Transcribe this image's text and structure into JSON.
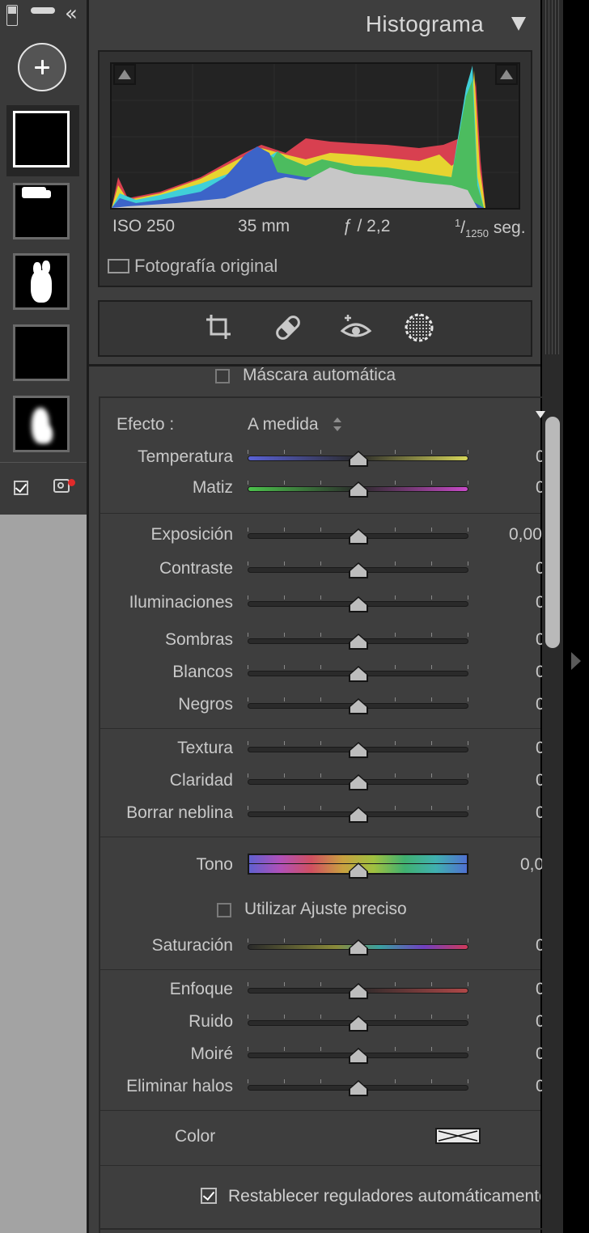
{
  "histogram": {
    "title": "Histograma",
    "exif": {
      "iso": "ISO 250",
      "focal": "35 mm",
      "aperture": "ƒ / 2,2",
      "shutter_num": "1",
      "shutter_den": "1250",
      "shutter_unit": "seg."
    },
    "original_photo_label": "Fotografía original"
  },
  "tools": [
    "crop-icon",
    "healing-icon",
    "redeye-icon",
    "masking-icon"
  ],
  "mask": {
    "auto_mask_label": "Máscara automática",
    "effect_label": "Efecto :",
    "effect_value": "A medida"
  },
  "sliders": {
    "temperatura": {
      "label": "Temperatura",
      "value": "0"
    },
    "matiz": {
      "label": "Matiz",
      "value": "0"
    },
    "exposicion": {
      "label": "Exposición",
      "value": "0,00"
    },
    "contraste": {
      "label": "Contraste",
      "value": "0"
    },
    "iluminaciones": {
      "label": "Iluminaciones",
      "value": "0"
    },
    "sombras": {
      "label": "Sombras",
      "value": "0"
    },
    "blancos": {
      "label": "Blancos",
      "value": "0"
    },
    "negros": {
      "label": "Negros",
      "value": "0"
    },
    "textura": {
      "label": "Textura",
      "value": "0"
    },
    "claridad": {
      "label": "Claridad",
      "value": "0"
    },
    "borrar_neblina": {
      "label": "Borrar neblina",
      "value": "0"
    },
    "tono": {
      "label": "Tono",
      "value": "0,0"
    },
    "saturacion": {
      "label": "Saturación",
      "value": "0"
    },
    "enfoque": {
      "label": "Enfoque",
      "value": "0"
    },
    "ruido": {
      "label": "Ruido",
      "value": "0"
    },
    "moire": {
      "label": "Moiré",
      "value": "0"
    },
    "eliminar_halos": {
      "label": "Eliminar halos",
      "value": "0"
    }
  },
  "precise_label": "Utilizar Ajuste preciso",
  "color_label": "Color",
  "reset_label": "Restablecer reguladores automáticamente",
  "colors": {
    "panel": "#3e3e3e",
    "track": "#2a2a2a",
    "knob": "#bdbdbd",
    "text": "#c9c9c9"
  }
}
